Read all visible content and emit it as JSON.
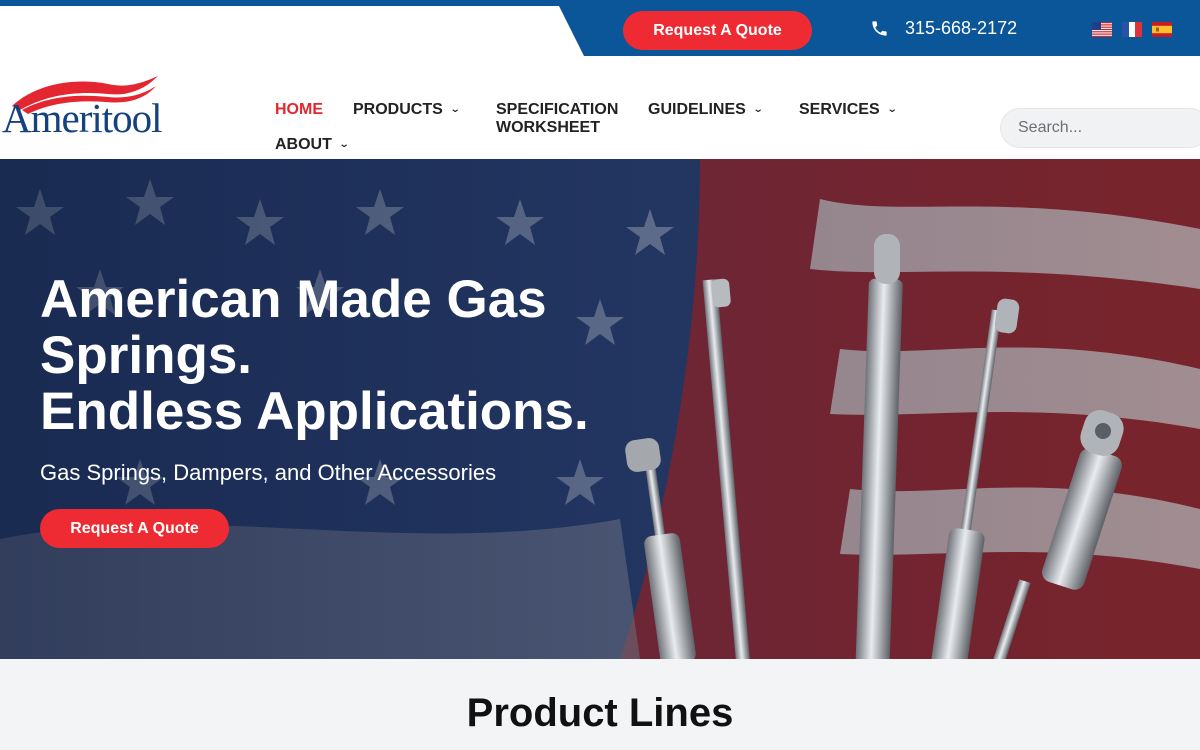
{
  "topbar": {
    "quote_label": "Request A Quote",
    "phone": "315-668-2172",
    "phone_icon": "phone-icon",
    "flags": [
      "flag-us-icon",
      "flag-fr-icon",
      "flag-es-icon"
    ]
  },
  "header": {
    "logo_text": "Ameritool",
    "nav": {
      "home": "HOME",
      "products": "PRODUCTS",
      "spec_line1": "SPECIFICATION",
      "spec_line2": "WORKSHEET",
      "guidelines": "GUIDELINES",
      "services": "SERVICES",
      "about": "ABOUT"
    },
    "search_placeholder": "Search...",
    "chevron_icon": "chevron-down-icon"
  },
  "hero": {
    "title_line1": "American Made Gas",
    "title_line2": "Springs.",
    "title_line3": "Endless Applications.",
    "subtitle": "Gas Springs, Dampers, and Other Accessories",
    "quote_label": "Request A Quote"
  },
  "products": {
    "heading": "Product Lines"
  },
  "colors": {
    "brand_blue": "#0a5699",
    "accent_red": "#ee2b33",
    "nav_active": "#e3262f",
    "logo_blue": "#14427f"
  }
}
